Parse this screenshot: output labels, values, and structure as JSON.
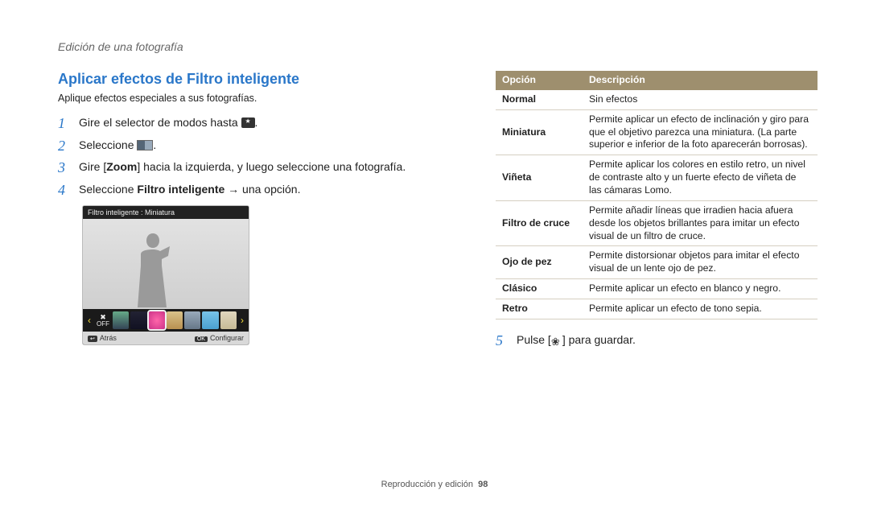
{
  "breadcrumb": "Edición de una fotografía",
  "title": "Aplicar efectos de Filtro inteligente",
  "intro": "Aplique efectos especiales a sus fotografías.",
  "steps": {
    "s1": "Gire el selector de modos hasta ",
    "s1_end": ".",
    "s2": "Seleccione ",
    "s2_end": ".",
    "s3_a": "Gire [",
    "s3_zoom": "Zoom",
    "s3_b": "] hacia la izquierda, y luego seleccione una fotografía.",
    "s4_a": "Seleccione ",
    "s4_bold": "Filtro inteligente",
    "s4_b": " → una opción.",
    "s5_a": "Pulse [",
    "s5_b": "] para guardar."
  },
  "screen": {
    "header": "Filtro inteligente : Miniatura",
    "off": "OFF",
    "back_key": "↩",
    "back_label": "Atrás",
    "ok_key": "OK",
    "ok_label": "Configurar"
  },
  "table": {
    "h1": "Opción",
    "h2": "Descripción",
    "rows": [
      {
        "opt": "Normal",
        "desc": "Sin efectos"
      },
      {
        "opt": "Miniatura",
        "desc": "Permite aplicar un efecto de inclinación y giro para que el objetivo parezca una miniatura. (La parte superior e inferior de la foto aparecerán borrosas)."
      },
      {
        "opt": "Viñeta",
        "desc": "Permite aplicar los colores en estilo retro, un nivel de contraste alto y un fuerte efecto de viñeta de las cámaras Lomo."
      },
      {
        "opt": "Filtro de cruce",
        "desc": "Permite añadir líneas que irradien hacia afuera desde los objetos brillantes para imitar un efecto visual de un filtro de cruce."
      },
      {
        "opt": "Ojo de pez",
        "desc": "Permite distorsionar objetos para imitar el efecto visual de un lente ojo de pez."
      },
      {
        "opt": "Clásico",
        "desc": "Permite aplicar un efecto en blanco y negro."
      },
      {
        "opt": "Retro",
        "desc": "Permite aplicar un efecto de tono sepia."
      }
    ]
  },
  "footer": {
    "section": "Reproducción y edición",
    "page": "98"
  }
}
